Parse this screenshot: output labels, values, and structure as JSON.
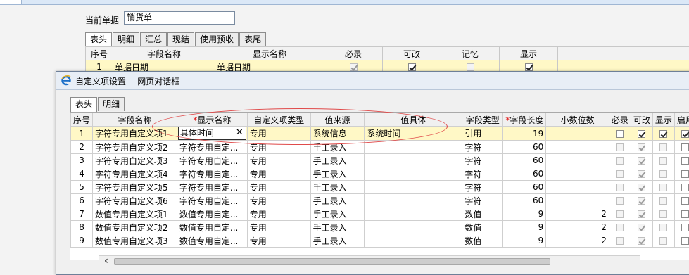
{
  "background": {
    "doc_label": "当前单据",
    "doc_value": "销货单",
    "tabs": [
      "表头",
      "明细",
      "汇总",
      "现结",
      "使用预收",
      "表尾"
    ],
    "columns": [
      "序号",
      "字段名称",
      "显示名称",
      "必录",
      "可改",
      "记忆",
      "显示"
    ],
    "row": {
      "no": "1",
      "field": "单据日期",
      "display": "单据日期"
    }
  },
  "dialog": {
    "title": "自定义项设置 -- 网页对话框",
    "tabs": [
      "表头",
      "明细"
    ],
    "columns": {
      "no": "序号",
      "field": "字段名称",
      "display": "显示名称",
      "custom_type": "自定义项类型",
      "source": "值来源",
      "detail": "值具体",
      "field_type": "字段类型",
      "length": "字段长度",
      "decimals": "小数位数",
      "required": "必录",
      "editable": "可改",
      "visible": "显示",
      "enabled": "启用"
    },
    "required_mark": "*",
    "rows": [
      {
        "no": "1",
        "field": "字符专用自定义项1",
        "display": "具体时间",
        "custom_type": "专用",
        "source": "系统信息",
        "detail": "系统时间",
        "field_type": "引用",
        "length": "19",
        "decimals": "",
        "required": false,
        "editable": true,
        "visible": true,
        "enabled": true
      },
      {
        "no": "2",
        "field": "字符专用自定义项2",
        "display": "字符专用自定...",
        "custom_type": "专用",
        "source": "手工录入",
        "detail": "",
        "field_type": "字符",
        "length": "60",
        "decimals": "",
        "required": false,
        "editable": true,
        "visible": false,
        "enabled": false
      },
      {
        "no": "3",
        "field": "字符专用自定义项3",
        "display": "字符专用自定...",
        "custom_type": "专用",
        "source": "手工录入",
        "detail": "",
        "field_type": "字符",
        "length": "60",
        "decimals": "",
        "required": false,
        "editable": true,
        "visible": false,
        "enabled": false
      },
      {
        "no": "4",
        "field": "字符专用自定义项4",
        "display": "字符专用自定...",
        "custom_type": "专用",
        "source": "手工录入",
        "detail": "",
        "field_type": "字符",
        "length": "60",
        "decimals": "",
        "required": false,
        "editable": true,
        "visible": false,
        "enabled": false
      },
      {
        "no": "5",
        "field": "字符专用自定义项5",
        "display": "字符专用自定...",
        "custom_type": "专用",
        "source": "手工录入",
        "detail": "",
        "field_type": "字符",
        "length": "60",
        "decimals": "",
        "required": false,
        "editable": true,
        "visible": false,
        "enabled": false
      },
      {
        "no": "6",
        "field": "字符专用自定义项6",
        "display": "字符专用自定...",
        "custom_type": "专用",
        "source": "手工录入",
        "detail": "",
        "field_type": "字符",
        "length": "60",
        "decimals": "",
        "required": false,
        "editable": true,
        "visible": false,
        "enabled": false
      },
      {
        "no": "7",
        "field": "数值专用自定义项1",
        "display": "数值专用自定...",
        "custom_type": "专用",
        "source": "手工录入",
        "detail": "",
        "field_type": "数值",
        "length": "9",
        "decimals": "2",
        "required": false,
        "editable": true,
        "visible": false,
        "enabled": false
      },
      {
        "no": "8",
        "field": "数值专用自定义项2",
        "display": "数值专用自定...",
        "custom_type": "专用",
        "source": "手工录入",
        "detail": "",
        "field_type": "数值",
        "length": "9",
        "decimals": "2",
        "required": false,
        "editable": true,
        "visible": false,
        "enabled": false
      },
      {
        "no": "9",
        "field": "数值专用自定义项3",
        "display": "数值专用自定...",
        "custom_type": "专用",
        "source": "手工录入",
        "detail": "",
        "field_type": "数值",
        "length": "9",
        "decimals": "2",
        "required": false,
        "editable": true,
        "visible": false,
        "enabled": false
      }
    ],
    "scroll_left_arrow": "‹"
  },
  "colors": {
    "selected_row": "#fff8c6",
    "annotation": "#e04a4a",
    "required_mark": "#e01010"
  }
}
